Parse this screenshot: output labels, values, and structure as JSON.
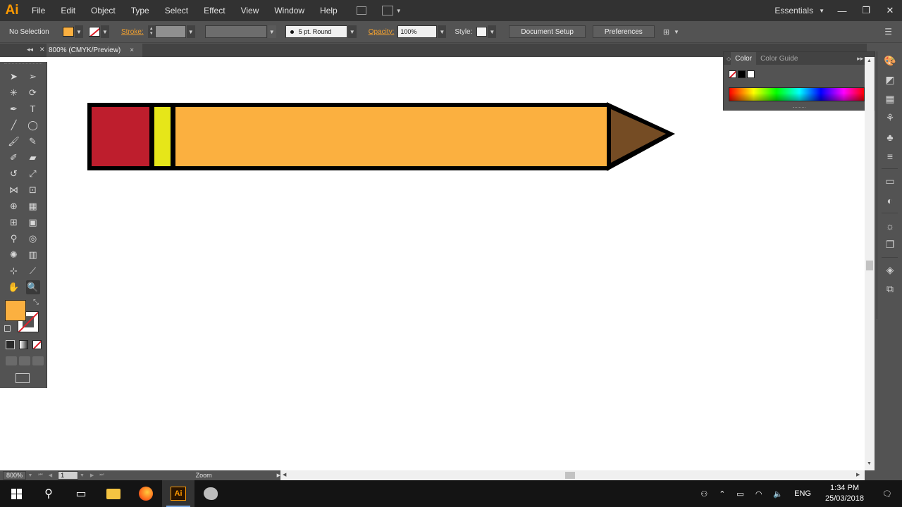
{
  "app": {
    "logo": "Ai",
    "accent": "#ff9a00"
  },
  "menu": {
    "items": [
      "File",
      "Edit",
      "Object",
      "Type",
      "Select",
      "Effect",
      "View",
      "Window",
      "Help"
    ]
  },
  "workspace": {
    "label": "Essentials"
  },
  "window_controls": {
    "minimize": "—",
    "restore": "❐",
    "close": "✕"
  },
  "control_bar": {
    "selection_status": "No Selection",
    "fill_color": "#fbb040",
    "stroke_label": "Stroke:",
    "brush": "5 pt. Round",
    "opacity_label": "Opacity:",
    "opacity_value": "100%",
    "style_label": "Style:",
    "document_setup": "Document Setup",
    "preferences": "Preferences"
  },
  "document": {
    "tab_title": "800% (CMYK/Preview)",
    "close": "×"
  },
  "artwork": {
    "outline_color": "#000000",
    "eraser_color": "#be1e2d",
    "ferrule_color": "#e6e619",
    "body_color": "#fbb040",
    "tip_color": "#754c24"
  },
  "tools": {
    "rows": [
      [
        "selection-tool",
        "direct-selection-tool"
      ],
      [
        "magic-wand-tool",
        "lasso-tool"
      ],
      [
        "pen-tool",
        "type-tool"
      ],
      [
        "line-segment-tool",
        "ellipse-tool"
      ],
      [
        "paintbrush-tool",
        "pencil-tool"
      ],
      [
        "blob-brush-tool",
        "eraser-tool"
      ],
      [
        "rotate-tool",
        "scale-tool"
      ],
      [
        "width-tool",
        "free-transform-tool"
      ],
      [
        "shape-builder-tool",
        "perspective-grid-tool"
      ],
      [
        "mesh-tool",
        "gradient-tool"
      ],
      [
        "eyedropper-tool",
        "blend-tool"
      ],
      [
        "symbol-sprayer-tool",
        "column-graph-tool"
      ],
      [
        "artboard-tool",
        "slice-tool"
      ],
      [
        "hand-tool",
        "zoom-tool"
      ]
    ],
    "glyphs": [
      [
        "➤",
        "➢"
      ],
      [
        "✳",
        "⟳"
      ],
      [
        "✒",
        "T"
      ],
      [
        "╱",
        "◯"
      ],
      [
        "🖌",
        "✎"
      ],
      [
        "✐",
        "▰"
      ],
      [
        "↺",
        "⤢"
      ],
      [
        "⋈",
        "⊡"
      ],
      [
        "⊕",
        "▦"
      ],
      [
        "⊞",
        "▣"
      ],
      [
        "⚲",
        "◎"
      ],
      [
        "✺",
        "▥"
      ],
      [
        "⊹",
        "⟋"
      ],
      [
        "✋",
        "🔍"
      ]
    ],
    "fill_color": "#fbb040"
  },
  "color_panel": {
    "tabs": [
      "Color",
      "Color Guide"
    ],
    "menu": "▸▸ ≡"
  },
  "dock": {
    "icons": [
      "color-icon",
      "color-guide-icon",
      "swatches-icon",
      "brushes-icon",
      "symbols-icon",
      "stroke-icon",
      "gradient-icon",
      "transparency-icon",
      "appearance-icon",
      "graphic-styles-icon",
      "layers-icon",
      "artboards-icon"
    ],
    "glyphs": [
      "🎨",
      "◩",
      "▦",
      "⚘",
      "♣",
      "≡",
      "▭",
      "◐",
      "☼",
      "❐",
      "◈",
      "⧉"
    ]
  },
  "status_bar": {
    "zoom": "800%",
    "page": "1",
    "info": "Zoom"
  },
  "taskbar": {
    "tray_lang": "ENG",
    "time": "1:34 PM",
    "date": "25/03/2018"
  }
}
